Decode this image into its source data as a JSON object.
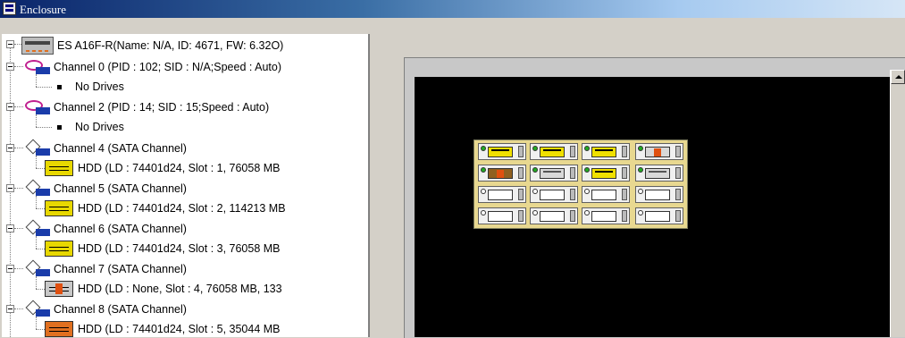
{
  "window": {
    "title": "Enclosure"
  },
  "tree": {
    "root": {
      "label": "ES A16F-R(Name: N/A, ID: 4671, FW: 6.32O)"
    },
    "channels": [
      {
        "label": "Channel 0 (PID : 102; SID : N/A;Speed : Auto)",
        "icon": "channel-icon",
        "child": "No Drives"
      },
      {
        "label": "Channel 2 (PID : 14; SID : 15;Speed : Auto)",
        "icon": "channel-icon",
        "child": "No Drives"
      },
      {
        "label": "Channel 4 (SATA Channel)",
        "icon": "sata-channel-icon",
        "child": "HDD  (LD : 74401d24, Slot : 1, 76058 MB"
      },
      {
        "label": "Channel 5 (SATA Channel)",
        "icon": "sata-channel-icon",
        "child": "HDD  (LD : 74401d24, Slot : 2, 114213 MB"
      },
      {
        "label": "Channel 6 (SATA Channel)",
        "icon": "sata-channel-icon",
        "child": "HDD  (LD : 74401d24, Slot : 3, 76058 MB"
      },
      {
        "label": "Channel 7 (SATA Channel)",
        "icon": "sata-channel-icon",
        "child": "HDD  (LD : None, Slot : 4, 76058 MB, 133"
      },
      {
        "label": "Channel 8 (SATA Channel)",
        "icon": "sata-channel-icon",
        "child": "HDD  (LD : 74401d24, Slot : 5, 35044 MB"
      }
    ]
  },
  "enclosure_view": {
    "slots": [
      [
        "yellow",
        "yellow",
        "yellow",
        "failed"
      ],
      [
        "failed-dark",
        "gray",
        "yellow",
        "gray"
      ],
      [
        "empty",
        "empty",
        "empty",
        "empty"
      ],
      [
        "empty",
        "empty",
        "empty",
        "empty"
      ]
    ]
  }
}
